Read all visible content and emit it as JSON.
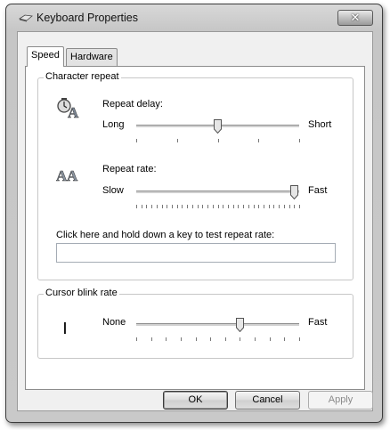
{
  "window": {
    "title": "Keyboard Properties",
    "close_label": "✕"
  },
  "tabs": [
    {
      "label": "Speed",
      "active": true
    },
    {
      "label": "Hardware",
      "active": false
    }
  ],
  "character_repeat": {
    "group_title": "Character repeat",
    "repeat_delay": {
      "label": "Repeat delay:",
      "min_label": "Long",
      "max_label": "Short",
      "value": 2,
      "steps": 4
    },
    "repeat_rate": {
      "label": "Repeat rate:",
      "min_label": "Slow",
      "max_label": "Fast",
      "value": 31,
      "steps": 32
    },
    "test_label": "Click here and hold down a key to test repeat rate:",
    "test_value": ""
  },
  "cursor_blink": {
    "group_title": "Cursor blink rate",
    "cursor_glyph": "|",
    "min_label": "None",
    "max_label": "Fast",
    "value": 7,
    "steps": 11
  },
  "buttons": {
    "ok": "OK",
    "cancel": "Cancel",
    "apply": "Apply"
  },
  "icons": {
    "title": "keyboard-icon",
    "repeat_delay": "clock-letter-icon",
    "repeat_rate": "double-letter-icon"
  }
}
